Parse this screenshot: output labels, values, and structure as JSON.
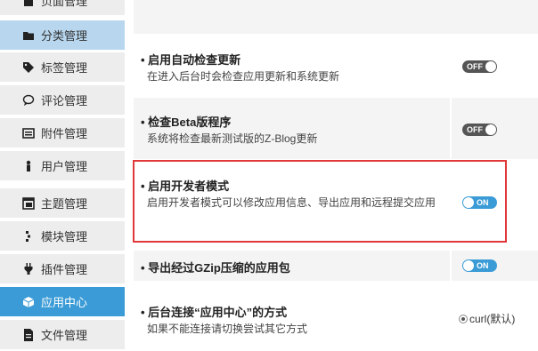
{
  "sidebar": {
    "items": [
      {
        "key": "page",
        "label": "页面管理",
        "icon": "page-icon"
      },
      {
        "key": "category",
        "label": "分类管理",
        "icon": "folder-icon"
      },
      {
        "key": "tag",
        "label": "标签管理",
        "icon": "tag-icon"
      },
      {
        "key": "comment",
        "label": "评论管理",
        "icon": "comment-icon"
      },
      {
        "key": "attachment",
        "label": "附件管理",
        "icon": "attachment-icon"
      },
      {
        "key": "user",
        "label": "用户管理",
        "icon": "user-icon"
      },
      {
        "key": "theme",
        "label": "主题管理",
        "icon": "theme-icon"
      },
      {
        "key": "module",
        "label": "模块管理",
        "icon": "module-icon"
      },
      {
        "key": "plugin",
        "label": "插件管理",
        "icon": "plugin-icon"
      },
      {
        "key": "appcenter",
        "label": "应用中心",
        "icon": "cube-icon"
      },
      {
        "key": "file",
        "label": "文件管理",
        "icon": "file-icon"
      }
    ]
  },
  "settings": {
    "auto_check": {
      "title": "• 启用自动检查更新",
      "desc": "在进入后台时会检查应用更新和系统更新",
      "toggle": "OFF"
    },
    "beta": {
      "title": "• 检查Beta版程序",
      "desc": "系统将检查最新测试版的Z-Blog更新",
      "toggle": "OFF"
    },
    "developer": {
      "title": "• 启用开发者模式",
      "desc": "启用开发者模式可以修改应用信息、导出应用和远程提交应用",
      "toggle": "ON"
    },
    "gzip": {
      "title": "• 导出经过GZip压缩的应用包",
      "toggle": "ON"
    },
    "connect": {
      "title": "• 后台连接“应用中心”的方式",
      "desc": "如果不能连接请切换尝试其它方式",
      "option": "curl(默认)"
    }
  }
}
